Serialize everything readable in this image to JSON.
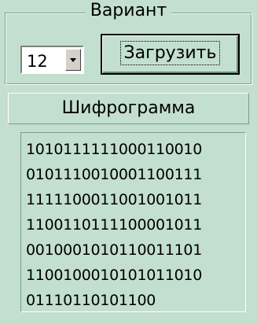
{
  "variant_group": {
    "caption": "Вариант",
    "selected_value": "12",
    "load_button_label": "Загрузить"
  },
  "cipher_section": {
    "label": "Шифрограмма",
    "lines": [
      "1010111111000110010",
      "0101110010001100111",
      "1111100011001001011",
      "1100110111100001011",
      "0010001010110011101",
      "1100100010101011010",
      "01110110101100"
    ]
  },
  "icons": {
    "dropdown": "chevron-down-icon"
  }
}
